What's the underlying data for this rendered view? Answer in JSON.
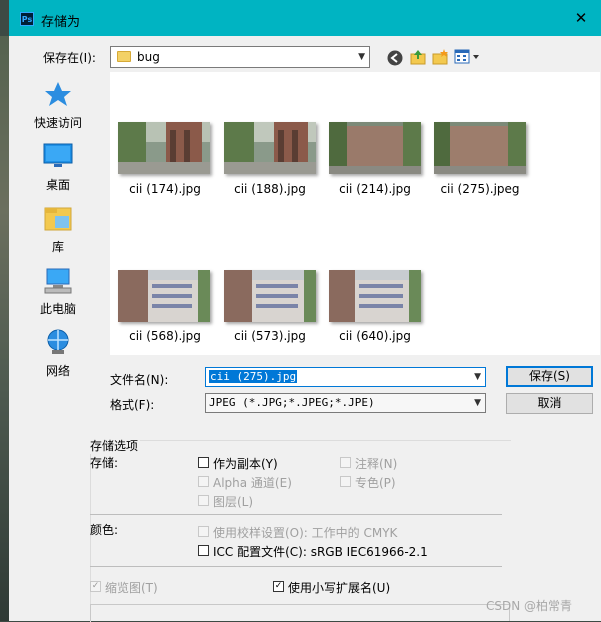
{
  "window": {
    "title": "存储为",
    "app_icon": "Ps",
    "close_glyph": "✕"
  },
  "location": {
    "label": "保存在(I):",
    "folder": "bug"
  },
  "sidebar": [
    {
      "label": "快速访问",
      "icon": "star-icon"
    },
    {
      "label": "桌面",
      "icon": "desktop-icon"
    },
    {
      "label": "库",
      "icon": "library-icon"
    },
    {
      "label": "此电脑",
      "icon": "computer-icon"
    },
    {
      "label": "网络",
      "icon": "network-icon"
    }
  ],
  "files": [
    {
      "name": "cii (174).jpg"
    },
    {
      "name": "cii (188).jpg"
    },
    {
      "name": "cii (214).jpg"
    },
    {
      "name": "cii (275).jpeg"
    },
    {
      "name": "cii (568).jpg"
    },
    {
      "name": "cii (573).jpg"
    },
    {
      "name": "cii (640).jpg"
    }
  ],
  "filename": {
    "label": "文件名(N):",
    "value": "cii (275).jpg"
  },
  "format": {
    "label": "格式(F):",
    "value": "JPEG (*.JPG;*.JPEG;*.JPE)"
  },
  "buttons": {
    "save": "保存(S)",
    "cancel": "取消"
  },
  "options": {
    "section_title": "存储选项",
    "save_label": "存储:",
    "as_copy": "作为副本(Y)",
    "notes": "注释(N)",
    "alpha": "Alpha 通道(E)",
    "spot": "专色(P)",
    "layers": "图层(L)",
    "color_label": "颜色:",
    "proof": "使用校样设置(O): 工作中的 CMYK",
    "icc": "ICC 配置文件(C): sRGB IEC61966-2.1",
    "thumbnail": "缩览图(T)",
    "lowercase_ext": "使用小写扩展名(U)"
  },
  "watermark": "CSDN @柏常青"
}
